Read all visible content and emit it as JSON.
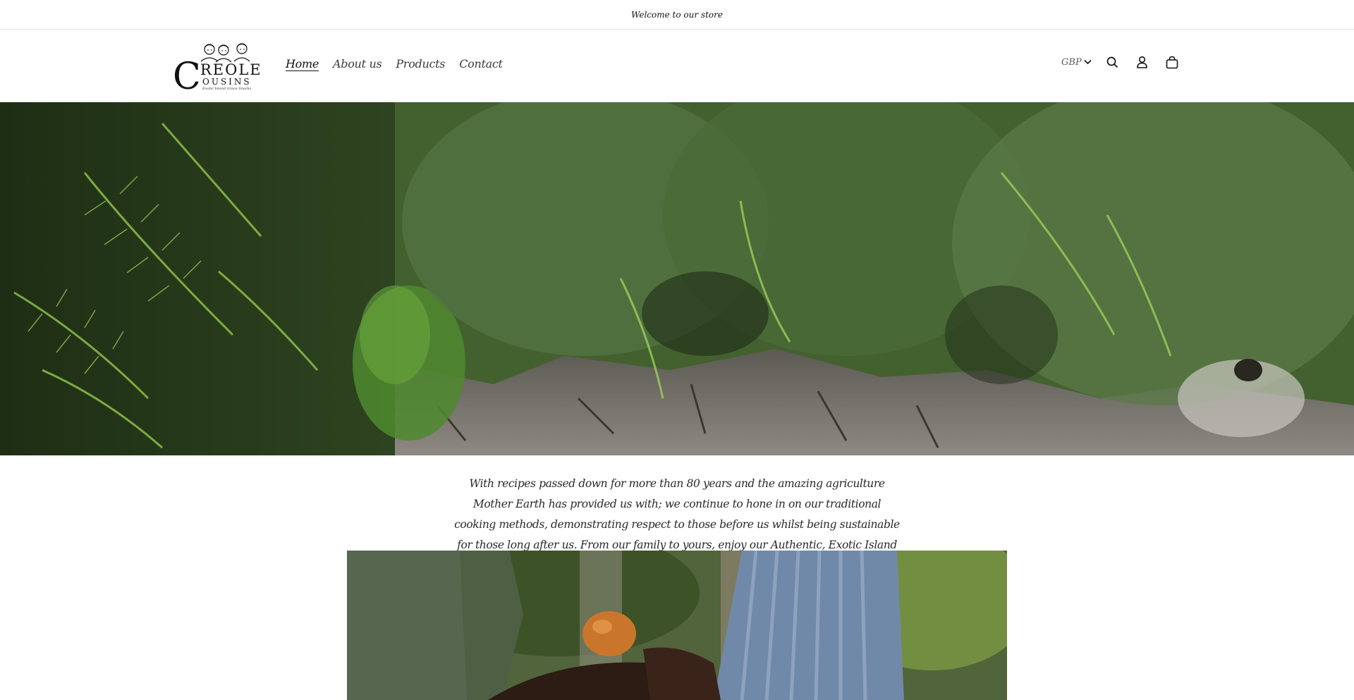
{
  "announcement": {
    "text": "Welcome to our store"
  },
  "logo": {
    "brand_line1": "REOLE",
    "brand_line2": "OUSINS",
    "brand_initial": "C",
    "tagline": "Exotic Island Grace Snacks"
  },
  "nav": {
    "items": [
      {
        "label": "Home"
      },
      {
        "label": "About us"
      },
      {
        "label": "Products"
      },
      {
        "label": "Contact"
      }
    ]
  },
  "header_tools": {
    "currency": "GBP",
    "icons": [
      "chevron-down-icon",
      "search-icon",
      "account-icon",
      "cart-icon"
    ]
  },
  "intro": {
    "text": "With recipes passed down for more than 80 years and the amazing agriculture Mother Earth has provided us with; we continue to hone in on our traditional cooking methods, demonstrating respect to those before us whilst being sustainable for those long after us. From our family to yours, enjoy our Authentic, Exotic Island Snacks."
  },
  "colors": {
    "text": "#121212",
    "border": "#e4e4e4",
    "hero_green": "#3e5c2c",
    "rock_grey": "#8a8580"
  }
}
